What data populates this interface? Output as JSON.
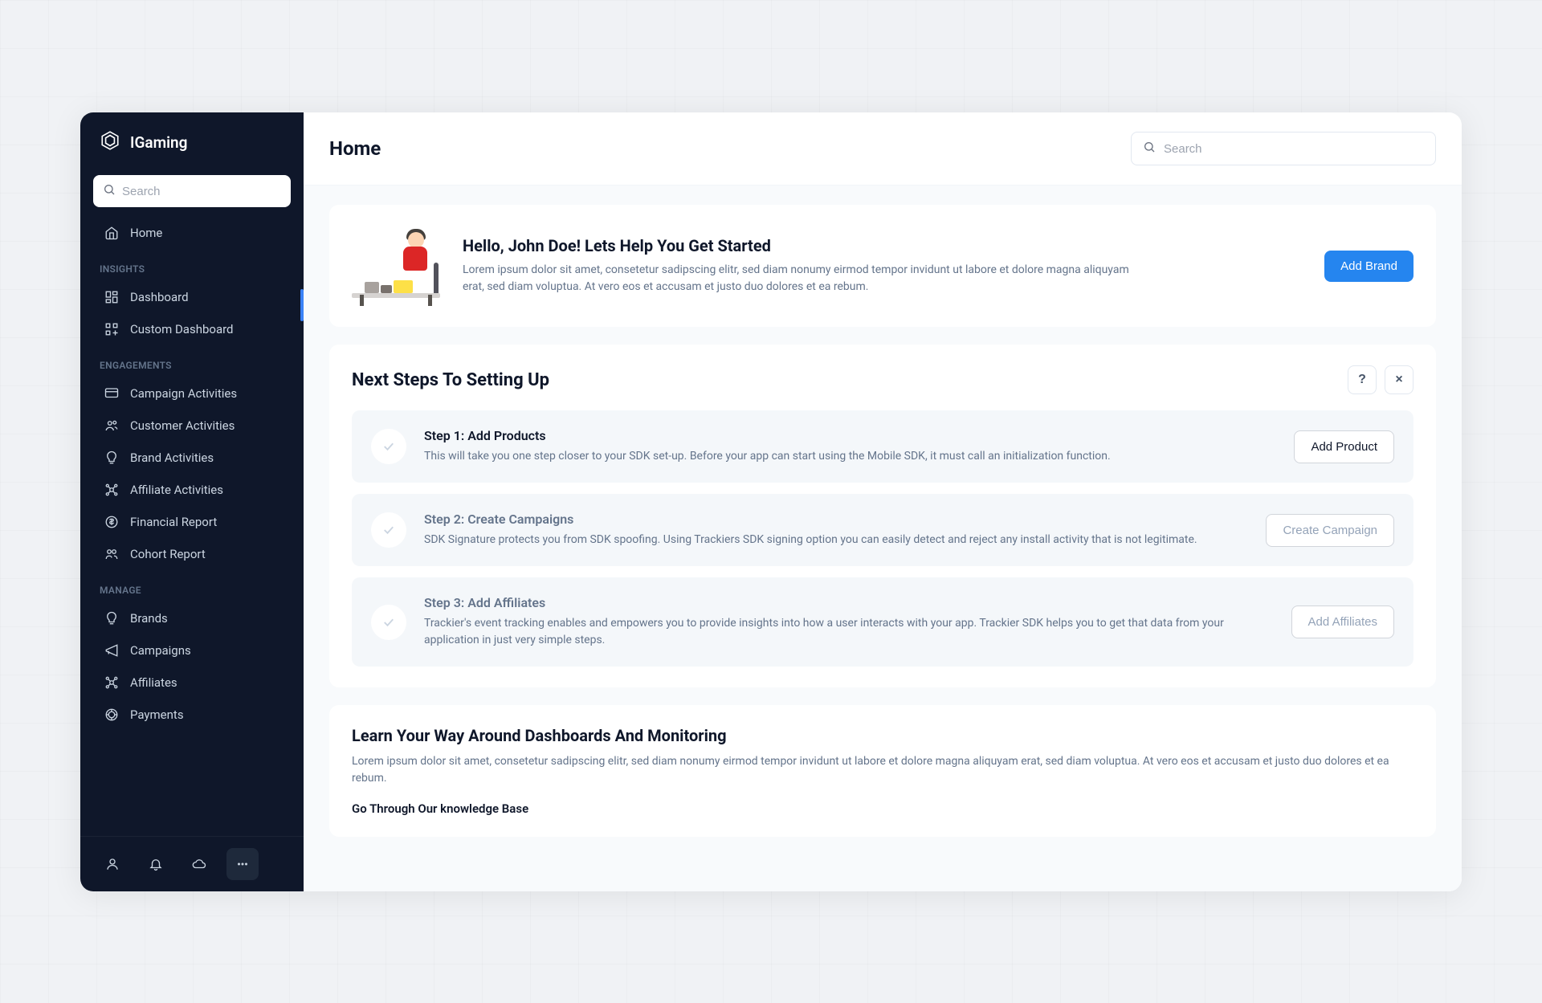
{
  "brand": {
    "name": "IGaming"
  },
  "sidebar": {
    "search_placeholder": "Search",
    "home_label": "Home",
    "sections": {
      "insights_label": "INSIGHTS",
      "engagements_label": "ENGAGEMENTS",
      "manage_label": "MANAGE"
    },
    "insights": [
      {
        "label": "Dashboard"
      },
      {
        "label": "Custom Dashboard"
      }
    ],
    "engagements": [
      {
        "label": "Campaign Activities"
      },
      {
        "label": "Customer Activities"
      },
      {
        "label": "Brand Activities"
      },
      {
        "label": "Affiliate Activities"
      },
      {
        "label": "Financial Report"
      },
      {
        "label": "Cohort Report"
      }
    ],
    "manage": [
      {
        "label": "Brands"
      },
      {
        "label": "Campaigns"
      },
      {
        "label": "Affiliates"
      },
      {
        "label": "Payments"
      }
    ]
  },
  "topbar": {
    "title": "Home",
    "search_placeholder": "Search"
  },
  "hero": {
    "title": "Hello, John Doe! Lets Help You Get Started",
    "desc": "Lorem ipsum dolor sit amet, consetetur sadipscing elitr, sed diam nonumy eirmod tempor invidunt ut labore et dolore magna aliquyam erat, sed diam voluptua. At vero eos et accusam et justo duo dolores et ea rebum.",
    "cta": "Add Brand"
  },
  "setup": {
    "title": "Next Steps To Setting Up",
    "help_label": "?",
    "close_label": "×",
    "steps": [
      {
        "title": "Step 1: Add Products",
        "desc": "This will take you one step closer to your SDK set-up. Before your app can start using the Mobile SDK, it must call an initialization function.",
        "cta": "Add Product"
      },
      {
        "title": "Step 2: Create Campaigns",
        "desc": "SDK Signature protects you from SDK spoofing. Using Trackiers SDK signing option you can easily detect and reject any install activity that is not legitimate.",
        "cta": "Create Campaign"
      },
      {
        "title": "Step 3: Add Affiliates",
        "desc": "Trackier's event tracking enables and empowers you to provide insights into how a user interacts with your app. Trackier SDK helps you to get that data from your application in just very simple steps.",
        "cta": "Add Affiliates"
      }
    ]
  },
  "learn": {
    "title": "Learn Your Way Around Dashboards And Monitoring",
    "desc": "Lorem ipsum dolor sit amet, consetetur sadipscing elitr, sed diam nonumy eirmod tempor invidunt ut labore et dolore magna aliquyam erat, sed diam voluptua. At vero eos et accusam et justo duo dolores et ea rebum.",
    "sub": "Go Through Our knowledge Base"
  }
}
